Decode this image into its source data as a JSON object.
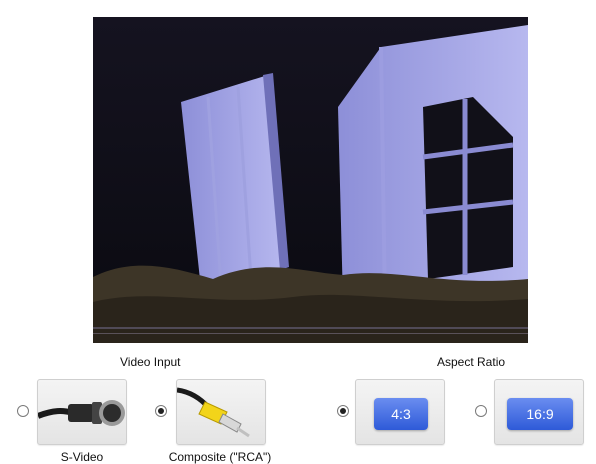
{
  "video_input": {
    "heading": "Video Input",
    "options": [
      {
        "label": "S-Video",
        "selected": false,
        "icon": "s-video-connector-icon"
      },
      {
        "label": "Composite (\"RCA\")",
        "selected": true,
        "icon": "rca-connector-icon"
      }
    ]
  },
  "aspect_ratio": {
    "heading": "Aspect Ratio",
    "options": [
      {
        "label": "4:3",
        "selected": true
      },
      {
        "label": "16:9",
        "selected": false
      }
    ]
  },
  "colors": {
    "ratio_chip": "#3f6be0",
    "rca_yellow": "#f2d41a"
  }
}
